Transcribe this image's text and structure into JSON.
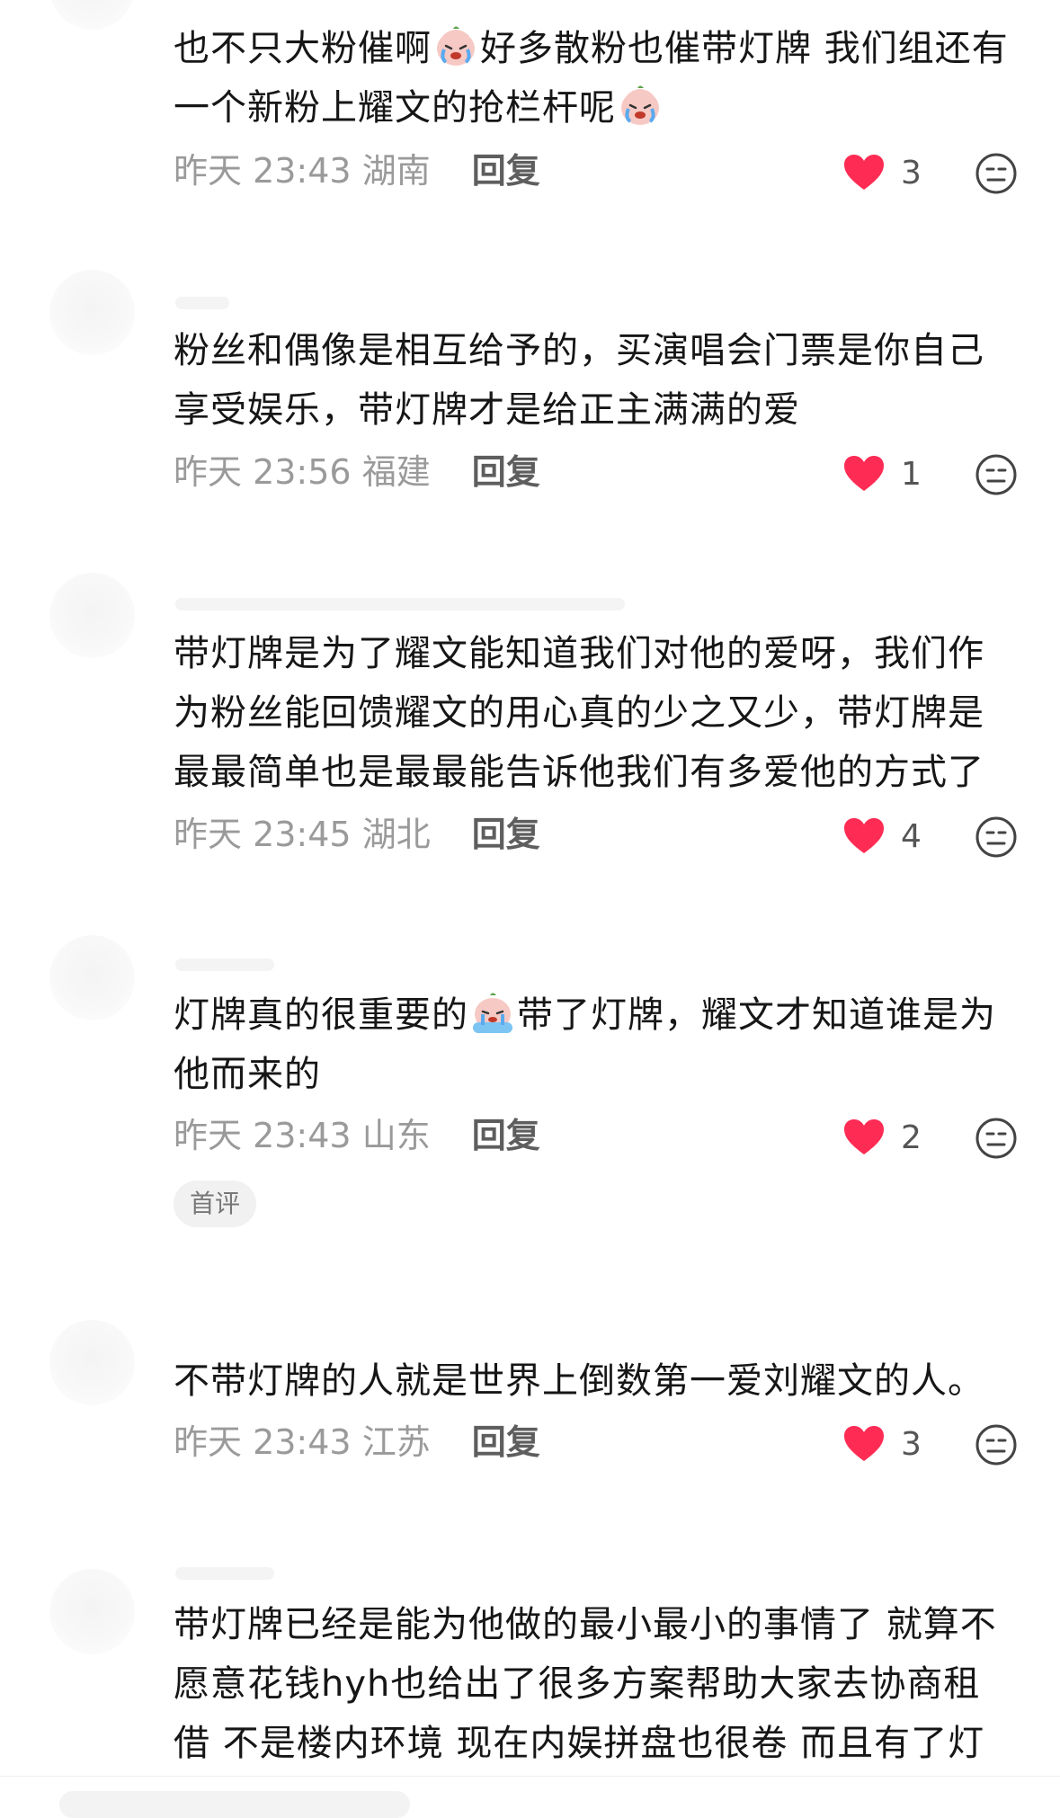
{
  "comments": [
    {
      "id": "c1",
      "segments": [
        "也不只大粉催啊",
        "好多散粉也催带灯牌 我们组还有一个新粉上耀文的抢栏杆呢",
        ""
      ],
      "time": "昨天 23:43",
      "region": "湖南",
      "reply_label": "回复",
      "likes": "3"
    },
    {
      "id": "c2",
      "text": "粉丝和偶像是相互给予的，买演唱会门票是你自己享受娱乐，带灯牌才是给正主满满的爱",
      "time": "昨天 23:56",
      "region": "福建",
      "reply_label": "回复",
      "likes": "1"
    },
    {
      "id": "c3",
      "text": "带灯牌是为了耀文能知道我们对他的爱呀，我们作为粉丝能回馈耀文的用心真的少之又少，带灯牌是最最简单也是最最能告诉他我们有多爱他的方式了",
      "time": "昨天 23:45",
      "region": "湖北",
      "reply_label": "回复",
      "likes": "4"
    },
    {
      "id": "c4",
      "segments": [
        "灯牌真的很重要的",
        "带了灯牌，耀文才知道谁是为他而来的"
      ],
      "time": "昨天 23:43",
      "region": "山东",
      "reply_label": "回复",
      "likes": "2",
      "badge": "首评"
    },
    {
      "id": "c5",
      "text": "不带灯牌的人就是世界上倒数第一爱刘耀文的人。",
      "time": "昨天 23:43",
      "region": "江苏",
      "reply_label": "回复",
      "likes": "3"
    },
    {
      "id": "c6",
      "text": "带灯牌已经是能为他做的最小最小的事情了 就算不愿意花钱hyh也给出了很多方案帮助大家去协商租借 不是楼内环境 现在内娱拼盘也很卷 而且有了灯"
    }
  ],
  "icons": {
    "like": "heart-icon",
    "react": "neutral-face-icon",
    "emoji_crying": "crying-emoji-icon",
    "emoji_sobbing": "sobbing-emoji-icon"
  },
  "colors": {
    "heart": "#fe2c55",
    "meta_text": "#9a9a9a",
    "body_text": "#161616"
  }
}
